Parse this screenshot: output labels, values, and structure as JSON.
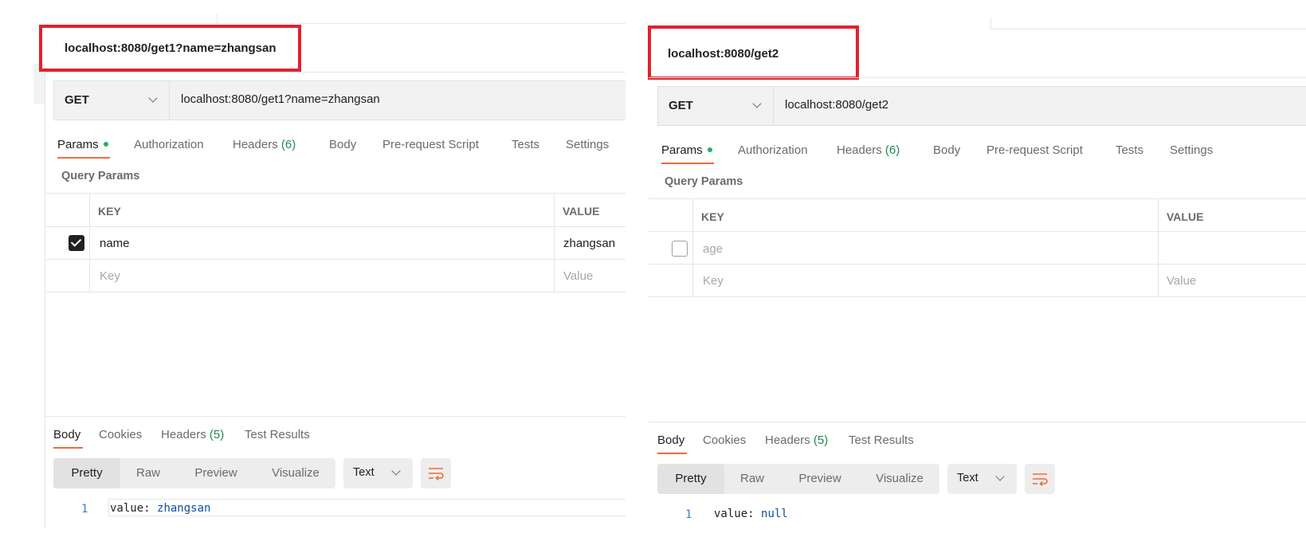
{
  "left": {
    "title": "localhost:8080/get1?name=zhangsan",
    "method": "GET",
    "url": "localhost:8080/get1?name=zhangsan",
    "request_tabs": {
      "params": "Params",
      "authorization": "Authorization",
      "headers": "Headers",
      "headers_count": "(6)",
      "body": "Body",
      "pre_request": "Pre-request Script",
      "tests": "Tests",
      "settings": "Settings"
    },
    "query_params_label": "Query Params",
    "table": {
      "key_header": "KEY",
      "value_header": "VALUE",
      "row_key": "name",
      "row_value": "zhangsan",
      "row_checked": true,
      "key_placeholder": "Key",
      "value_placeholder": "Value"
    },
    "response_tabs": {
      "body": "Body",
      "cookies": "Cookies",
      "headers": "Headers",
      "headers_count": "(5)",
      "test_results": "Test Results"
    },
    "view_modes": [
      "Pretty",
      "Raw",
      "Preview",
      "Visualize"
    ],
    "format": "Text",
    "code": {
      "line": "1",
      "key": "value:",
      "value": "zhangsan"
    }
  },
  "right": {
    "title": "localhost:8080/get2",
    "method": "GET",
    "url": "localhost:8080/get2",
    "request_tabs": {
      "params": "Params",
      "authorization": "Authorization",
      "headers": "Headers",
      "headers_count": "(6)",
      "body": "Body",
      "pre_request": "Pre-request Script",
      "tests": "Tests",
      "settings": "Settings"
    },
    "query_params_label": "Query Params",
    "table": {
      "key_header": "KEY",
      "value_header": "VALUE",
      "row_key": "age",
      "row_value": "",
      "row_checked": false,
      "key_placeholder": "Key",
      "value_placeholder": "Value"
    },
    "response_tabs": {
      "body": "Body",
      "cookies": "Cookies",
      "headers": "Headers",
      "headers_count": "(5)",
      "test_results": "Test Results"
    },
    "view_modes": [
      "Pretty",
      "Raw",
      "Preview",
      "Visualize"
    ],
    "format": "Text",
    "code": {
      "line": "1",
      "key": "value:",
      "value": "null"
    }
  },
  "colors": {
    "highlight_box": "#e3202e",
    "active_tab_underline": "#f26b3a",
    "params_dot": "#1fb35e",
    "count_green": "#1f8a4c",
    "line_number_blue": "#3a7bd5"
  }
}
